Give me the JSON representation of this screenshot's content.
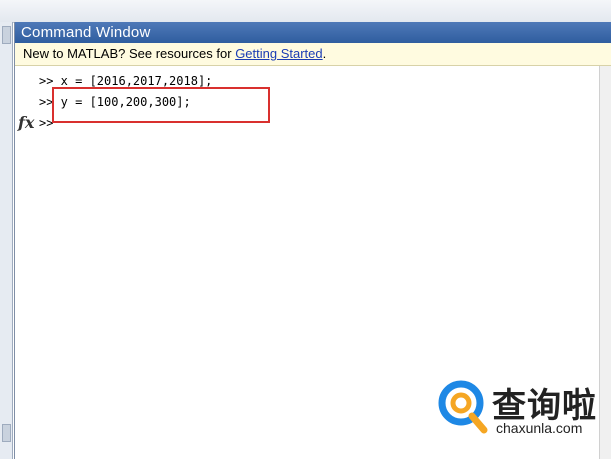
{
  "window": {
    "title": "Command Window"
  },
  "info_bar": {
    "text": "New to MATLAB? See resources for ",
    "link": "Getting Started",
    "suffix": "."
  },
  "console": {
    "lines": [
      {
        "prompt": ">>",
        "code": " x = [2016,2017,2018];"
      },
      {
        "prompt": ">>",
        "code": " y = [100,200,300];"
      },
      {
        "prompt": ">>",
        "code": ""
      }
    ]
  },
  "icons": {
    "fx": "fx",
    "watermark_logo": "magnifier-q-logo"
  },
  "watermark": {
    "brand": "查询啦",
    "url": "chaxunla.com"
  },
  "colors": {
    "title_bar": "#3a68ab",
    "info_bg": "#fffbe0",
    "highlight": "#d9302e",
    "logo_blue": "#1e88e5",
    "logo_orange": "#f5a623"
  }
}
